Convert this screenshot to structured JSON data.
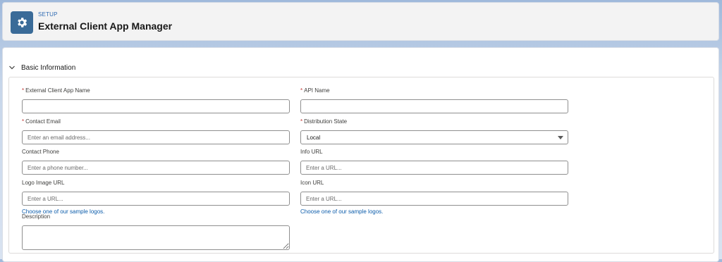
{
  "header": {
    "eyebrow": "SETUP",
    "title": "External Client App Manager",
    "icon": "gear-icon",
    "icon_bg": "#3a6b98"
  },
  "section": {
    "title": "Basic Information",
    "icon": "chevron-down-icon"
  },
  "fields": {
    "app_name": {
      "label": "External Client App Name",
      "value": "",
      "placeholder": ""
    },
    "api_name": {
      "label": "API Name",
      "value": "",
      "placeholder": ""
    },
    "contact_email": {
      "label": "Contact Email",
      "value": "",
      "placeholder": "Enter an email address..."
    },
    "distribution_state": {
      "label": "Distribution State",
      "value": "Local"
    },
    "contact_phone": {
      "label": "Contact Phone",
      "value": "",
      "placeholder": "Enter a phone number..."
    },
    "info_url": {
      "label": "Info URL",
      "value": "",
      "placeholder": "Enter a URL..."
    },
    "logo_url": {
      "label": "Logo Image URL",
      "value": "",
      "placeholder": "Enter a URL...",
      "link": "Choose one of our sample logos."
    },
    "icon_url": {
      "label": "Icon URL",
      "value": "",
      "placeholder": "Enter a URL...",
      "link": "Choose one of our sample logos."
    },
    "description": {
      "label": "Description",
      "value": ""
    }
  },
  "required_marker": "*",
  "colors": {
    "link": "#0b5cab",
    "required": "#c23934"
  }
}
